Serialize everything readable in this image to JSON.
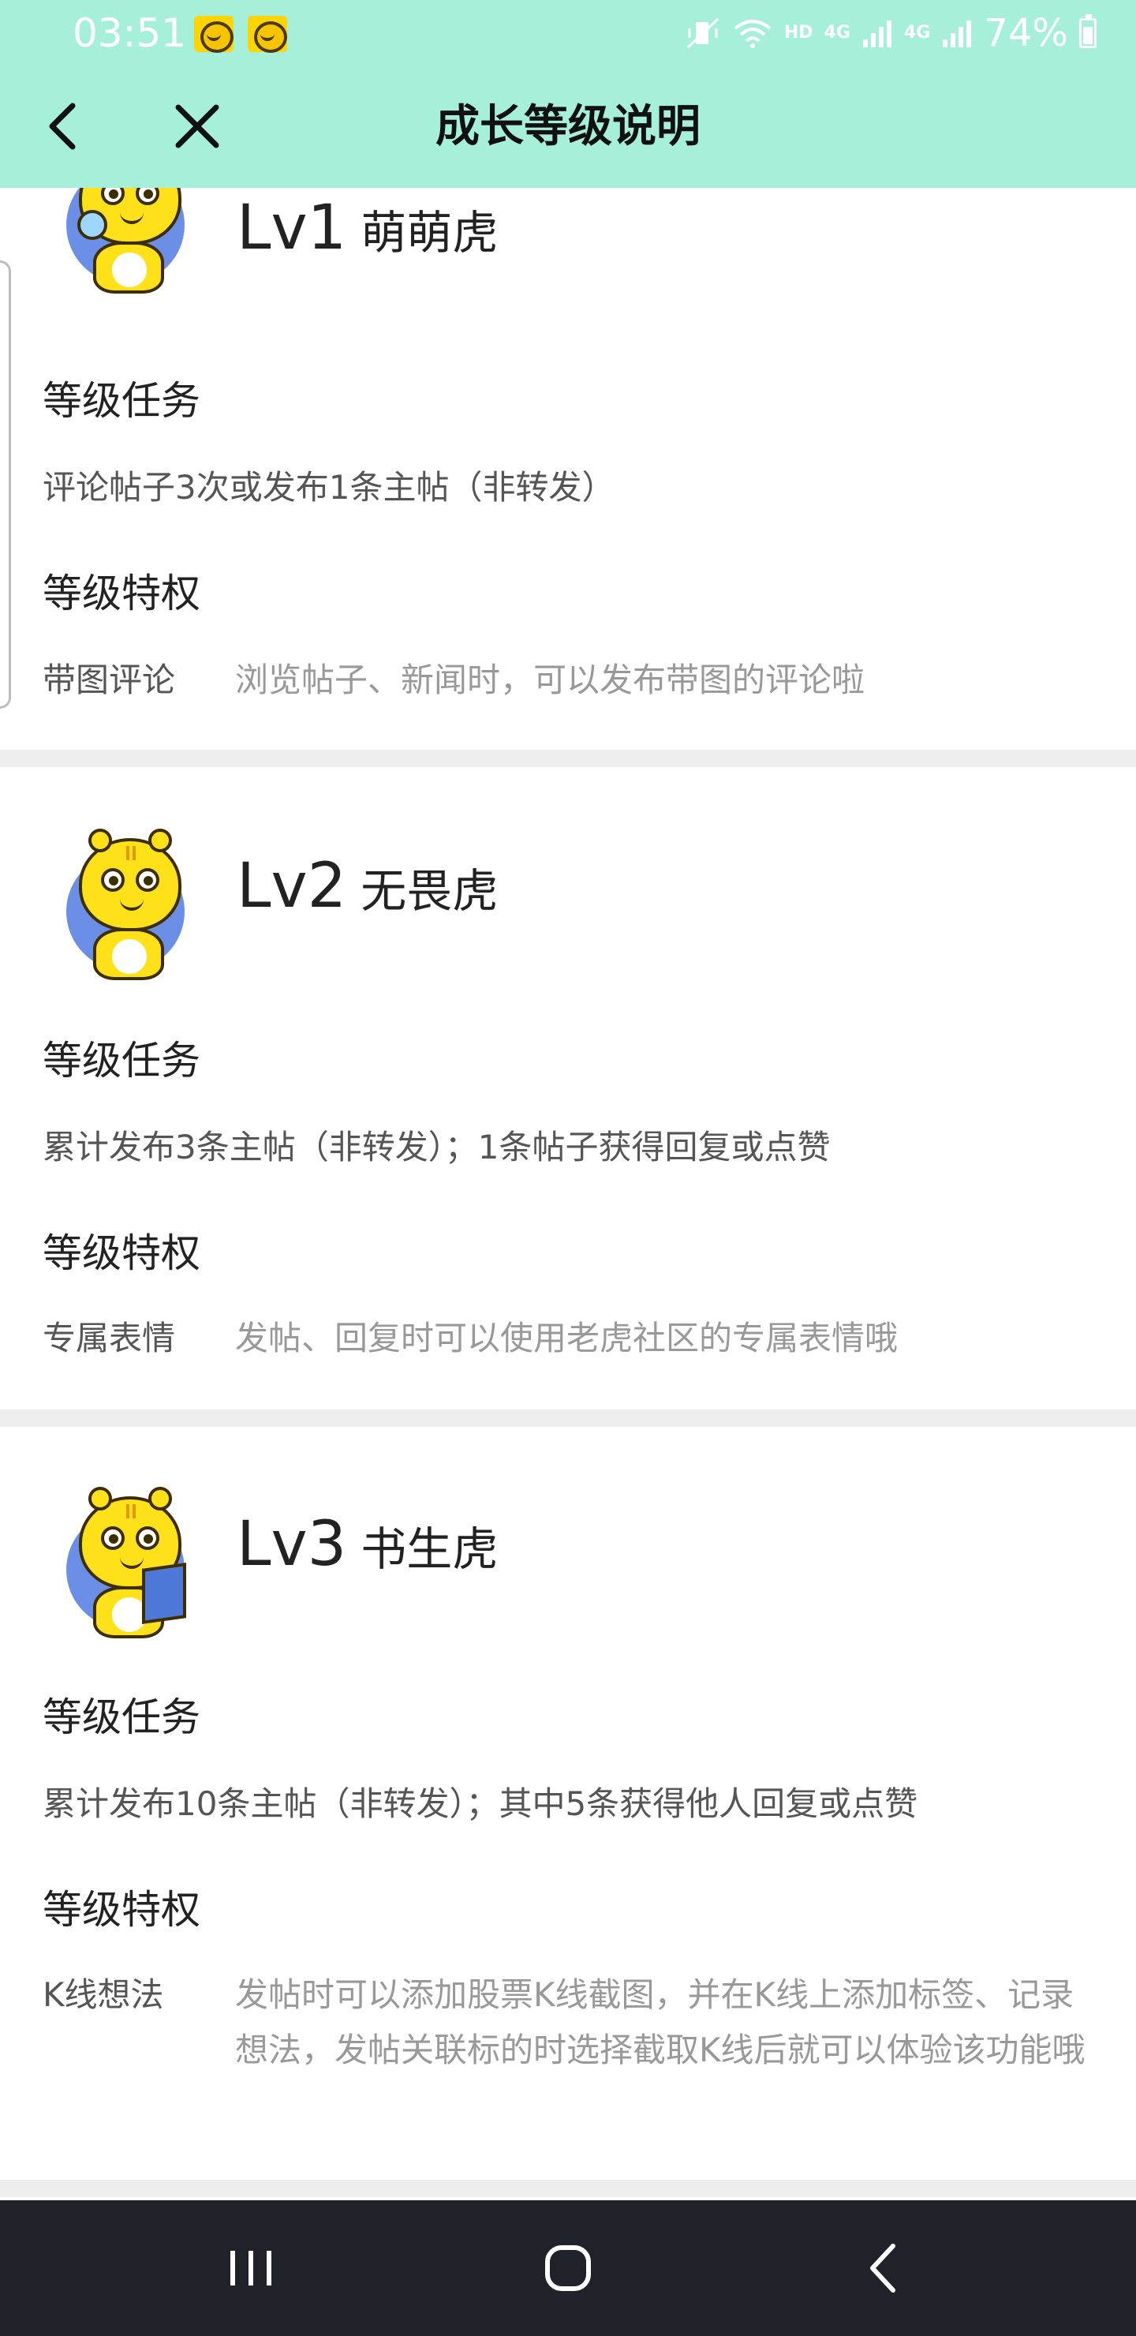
{
  "status_bar": {
    "time": "03:51",
    "network_label": "HD",
    "signal_label_1": "4G",
    "signal_label_2": "4G",
    "battery": "74%",
    "notification_icons": [
      "tiger-app-icon",
      "tiger-app-icon"
    ]
  },
  "header": {
    "title": "成长等级说明",
    "back_icon": "chevron-left-icon",
    "close_icon": "close-icon",
    "background": "#a6f0d9"
  },
  "levels": [
    {
      "code": "Lv1",
      "name": "萌萌虎",
      "task_heading": "等级任务",
      "task": "评论帖子3次或发布1条主帖（非转发）",
      "perk_heading": "等级特权",
      "perk_label": "带图评论",
      "perk_desc": "浏览帖子、新闻时，可以发布带图的评论啦",
      "avatar_icon": "baby-tiger-icon"
    },
    {
      "code": "Lv2",
      "name": "无畏虎",
      "task_heading": "等级任务",
      "task": "累计发布3条主帖（非转发）；1条帖子获得回复或点赞",
      "perk_heading": "等级特权",
      "perk_label": "专属表情",
      "perk_desc": "发帖、回复时可以使用老虎社区的专属表情哦",
      "avatar_icon": "thinking-tiger-icon"
    },
    {
      "code": "Lv3",
      "name": "书生虎",
      "task_heading": "等级任务",
      "task": "累计发布10条主帖（非转发）；其中5条获得他人回复或点赞",
      "perk_heading": "等级特权",
      "perk_label": "K线想法",
      "perk_desc": "发帖时可以添加股票K线截图，并在K线上添加标签、记录想法，发帖关联标的时选择截取K线后就可以体验该功能哦",
      "avatar_icon": "reading-tiger-icon"
    }
  ],
  "nav_bar": {
    "recents_icon": "recents-icon",
    "home_icon": "home-icon",
    "back_icon": "back-icon",
    "background": "#1f2329"
  }
}
